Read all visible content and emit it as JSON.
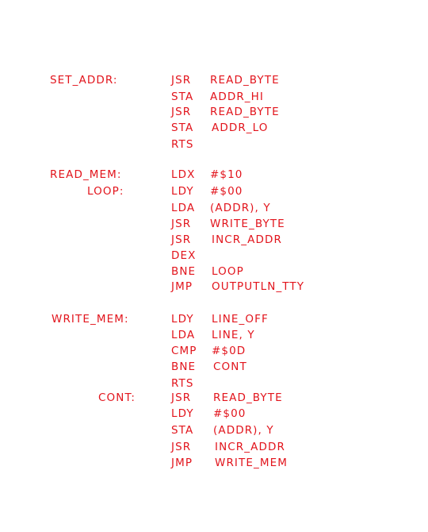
{
  "ink_color": "#e2141c",
  "listing": [
    {
      "label": "SET_ADDR:",
      "op": "JSR",
      "arg": "READ_BYTE"
    },
    {
      "label": "",
      "op": "STA",
      "arg": "ADDR_HI"
    },
    {
      "label": "",
      "op": "JSR",
      "arg": "READ_BYTE"
    },
    {
      "label": "",
      "op": "STA",
      "arg": "ADDR_LO"
    },
    {
      "label": "",
      "op": "RTS",
      "arg": ""
    },
    {
      "label": "READ_MEM:",
      "op": "LDX",
      "arg": "#$10"
    },
    {
      "label": "LOOP:",
      "op": "LDY",
      "arg": "#$00"
    },
    {
      "label": "",
      "op": "LDA",
      "arg": "(ADDR), Y"
    },
    {
      "label": "",
      "op": "JSR",
      "arg": "WRITE_BYTE"
    },
    {
      "label": "",
      "op": "JSR",
      "arg": "INCR_ADDR"
    },
    {
      "label": "",
      "op": "DEX",
      "arg": ""
    },
    {
      "label": "",
      "op": "BNE",
      "arg": "LOOP"
    },
    {
      "label": "",
      "op": "JMP",
      "arg": "OUTPUTLN_TTY"
    },
    {
      "label": "WRITE_MEM:",
      "op": "LDY",
      "arg": "LINE_OFF"
    },
    {
      "label": "",
      "op": "LDA",
      "arg": "LINE, Y"
    },
    {
      "label": "",
      "op": "CMP",
      "arg": "#$0D"
    },
    {
      "label": "",
      "op": "BNE",
      "arg": "CONT"
    },
    {
      "label": "",
      "op": "RTS",
      "arg": ""
    },
    {
      "label": "CONT:",
      "op": "JSR",
      "arg": "READ_BYTE"
    },
    {
      "label": "",
      "op": "LDY",
      "arg": "#$00"
    },
    {
      "label": "",
      "op": "STA",
      "arg": "(ADDR), Y"
    },
    {
      "label": "",
      "op": "JSR",
      "arg": "INCR_ADDR"
    },
    {
      "label": "",
      "op": "JMP",
      "arg": "WRITE_MEM"
    }
  ]
}
